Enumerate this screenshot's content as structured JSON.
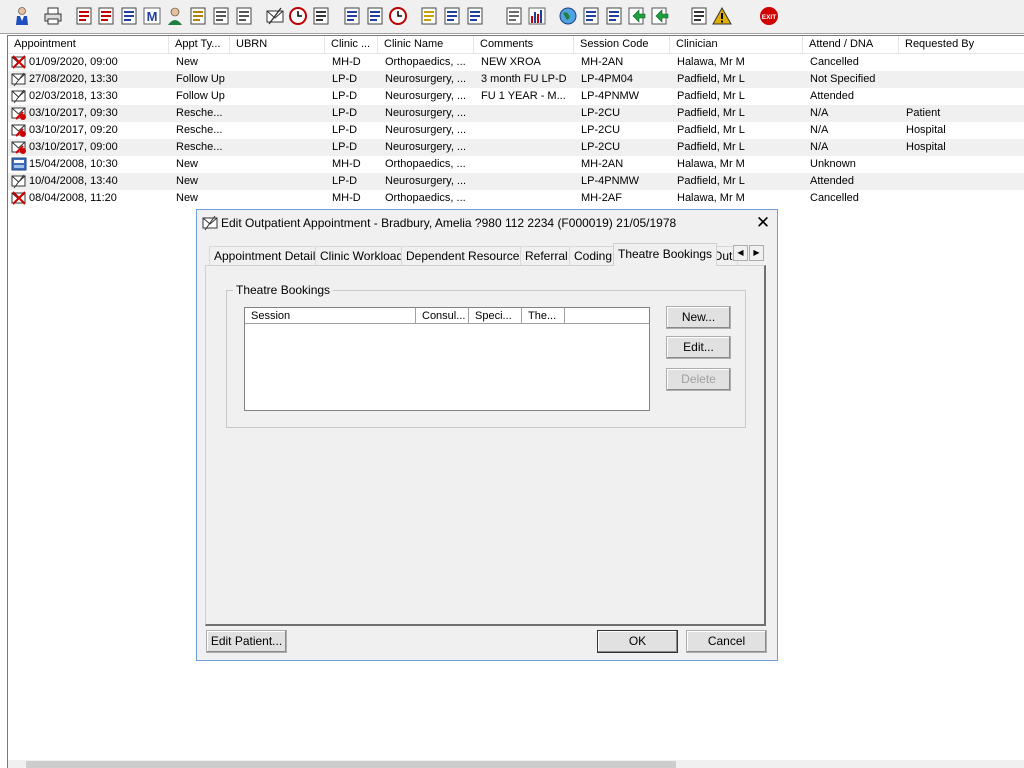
{
  "toolbar": {
    "buttons": [
      {
        "name": "patient-search-icon",
        "color": "#1f4fbf"
      },
      {
        "name": "print-icon",
        "color": "#6b6b6b"
      },
      {
        "name": "book-icon",
        "color": "#c00000"
      },
      {
        "name": "book-edit-icon",
        "color": "#c00000"
      },
      {
        "name": "summary-icon",
        "color": "#1f3f9f"
      },
      {
        "name": "letter-m-icon",
        "color": "#1f3f9f"
      },
      {
        "name": "clinician-icon",
        "color": "#1f7f3f"
      },
      {
        "name": "notes-icon",
        "color": "#b08000"
      },
      {
        "name": "flag-icon",
        "color": "#555555"
      },
      {
        "name": "flag-alt-icon",
        "color": "#555555"
      },
      {
        "name": "envelope-icon",
        "color": "#333333"
      },
      {
        "name": "clock-icon",
        "color": "#c00000"
      },
      {
        "name": "list-icon",
        "color": "#333333"
      },
      {
        "name": "document-icon",
        "color": "#1f3f9f"
      },
      {
        "name": "form-icon",
        "color": "#1f3f9f"
      },
      {
        "name": "timer-icon",
        "color": "#c00000"
      },
      {
        "name": "note-yellow-icon",
        "color": "#c8a000"
      },
      {
        "name": "bed-icon",
        "color": "#1f3f9f"
      },
      {
        "name": "people-icon",
        "color": "#1f3f9f"
      },
      {
        "name": "page-icon",
        "color": "#6b6b6b"
      },
      {
        "name": "chart-icon",
        "color": "#1f3f9f"
      },
      {
        "name": "globe-icon",
        "color": "#1f7f3f"
      },
      {
        "name": "referral-icon",
        "color": "#1f3f9f"
      },
      {
        "name": "referral-check-icon",
        "color": "#1f3f9f"
      },
      {
        "name": "refer-green-icon",
        "color": "#1f9f3f"
      },
      {
        "name": "refer-green-alt-icon",
        "color": "#1f9f3f"
      },
      {
        "name": "transfer-icon",
        "color": "#333333"
      },
      {
        "name": "warning-icon",
        "color": "#e0b000"
      },
      {
        "name": "exit-icon",
        "color": "#d00000"
      }
    ],
    "exit_label": "EXIT"
  },
  "list": {
    "columns": [
      "Appointment",
      "Appt Ty...",
      "UBRN",
      "Clinic ...",
      "Clinic Name",
      "Comments",
      "Session Code",
      "Clinician",
      "Attend / DNA",
      "Requested By"
    ],
    "rows": [
      {
        "icon": "cancelled-appt-icon",
        "appointment": "01/09/2020, 09:00",
        "type": "New",
        "ubrn": "",
        "clinic": "MH-D",
        "clinic_name": "Orthopaedics, ...",
        "comments": "NEW XROA",
        "session": "MH-2AN",
        "clinician": "Halawa, Mr M",
        "attend": "Cancelled",
        "requested": ""
      },
      {
        "icon": "appt-icon",
        "appointment": "27/08/2020, 13:30",
        "type": "Follow Up",
        "ubrn": "",
        "clinic": "LP-D",
        "clinic_name": "Neurosurgery, ...",
        "comments": "3 month FU LP-D",
        "session": "LP-4PM04",
        "clinician": "Padfield, Mr L",
        "attend": "Not Specified",
        "requested": ""
      },
      {
        "icon": "appt-icon",
        "appointment": "02/03/2018, 13:30",
        "type": "Follow Up",
        "ubrn": "",
        "clinic": "LP-D",
        "clinic_name": "Neurosurgery, ...",
        "comments": "FU 1 YEAR - M...",
        "session": "LP-4PNMW",
        "clinician": "Padfield, Mr L",
        "attend": "Attended",
        "requested": ""
      },
      {
        "icon": "rescheduled-appt-icon",
        "appointment": "03/10/2017, 09:30",
        "type": "Resche...",
        "ubrn": "",
        "clinic": "LP-D",
        "clinic_name": "Neurosurgery, ...",
        "comments": "",
        "session": "LP-2CU",
        "clinician": "Padfield, Mr L",
        "attend": "N/A",
        "requested": "Patient"
      },
      {
        "icon": "rescheduled-appt-icon",
        "appointment": "03/10/2017, 09:20",
        "type": "Resche...",
        "ubrn": "",
        "clinic": "LP-D",
        "clinic_name": "Neurosurgery, ...",
        "comments": "",
        "session": "LP-2CU",
        "clinician": "Padfield, Mr L",
        "attend": "N/A",
        "requested": "Hospital"
      },
      {
        "icon": "rescheduled-appt-icon",
        "appointment": "03/10/2017, 09:00",
        "type": "Resche...",
        "ubrn": "",
        "clinic": "LP-D",
        "clinic_name": "Neurosurgery, ...",
        "comments": "",
        "session": "LP-2CU",
        "clinician": "Padfield, Mr L",
        "attend": "N/A",
        "requested": "Hospital"
      },
      {
        "icon": "unknown-appt-icon",
        "appointment": "15/04/2008, 10:30",
        "type": "New",
        "ubrn": "",
        "clinic": "MH-D",
        "clinic_name": "Orthopaedics, ...",
        "comments": "",
        "session": "MH-2AN",
        "clinician": "Halawa, Mr M",
        "attend": "Unknown",
        "requested": ""
      },
      {
        "icon": "appt-icon",
        "appointment": "10/04/2008, 13:40",
        "type": "New",
        "ubrn": "",
        "clinic": "LP-D",
        "clinic_name": "Neurosurgery, ...",
        "comments": "",
        "session": "LP-4PNMW",
        "clinician": "Padfield, Mr L",
        "attend": "Attended",
        "requested": ""
      },
      {
        "icon": "cancelled-appt-icon",
        "appointment": "08/04/2008, 11:20",
        "type": "New",
        "ubrn": "",
        "clinic": "MH-D",
        "clinic_name": "Orthopaedics, ...",
        "comments": "",
        "session": "MH-2AF",
        "clinician": "Halawa, Mr M",
        "attend": "Cancelled",
        "requested": ""
      }
    ]
  },
  "dialog": {
    "title": "Edit Outpatient Appointment - Bradbury, Amelia ?980 112 2234 (F000019) 21/05/1978",
    "close_label": "✕",
    "tabs": [
      "Appointment Details",
      "Clinic Workload",
      "Dependent Resources",
      "Referral",
      "Coding",
      "Theatre Bookings",
      "Out"
    ],
    "active_tab": "Theatre Bookings",
    "tab_left_arrow": "◀",
    "tab_right_arrow": "▶",
    "group_label": "Theatre Bookings",
    "inner_columns": [
      "Session",
      "Consul...",
      "Speci...",
      "The..."
    ],
    "buttons": {
      "new": "New...",
      "edit": "Edit...",
      "delete": "Delete"
    },
    "footer": {
      "edit_patient": "Edit Patient...",
      "ok": "OK",
      "cancel": "Cancel"
    }
  }
}
